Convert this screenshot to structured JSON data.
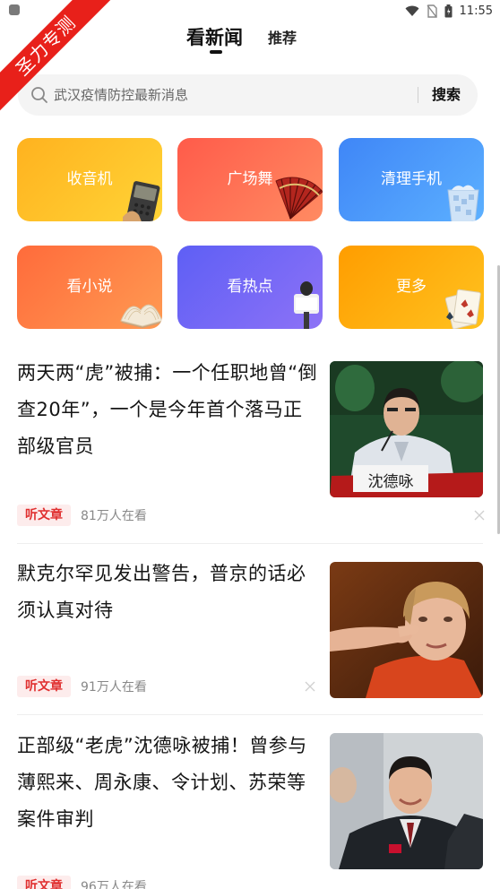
{
  "status_bar": {
    "time": "11:55",
    "icons": [
      "wifi-icon",
      "no-sim-icon",
      "battery-icon"
    ]
  },
  "watermark": {
    "text": "圣力专测"
  },
  "header": {
    "tabs": [
      {
        "label": "看新闻",
        "active": true
      },
      {
        "label": "推荐",
        "active": false
      }
    ]
  },
  "search": {
    "placeholder": "武汉疫情防控最新消息",
    "button_label": "搜索"
  },
  "shortcuts": [
    {
      "label": "收音机",
      "icon": "radio-icon",
      "color": "#ffbf28"
    },
    {
      "label": "广场舞",
      "icon": "fan-icon",
      "color": "#ff6a52"
    },
    {
      "label": "清理手机",
      "icon": "trash-bin-icon",
      "color": "#4c96fa"
    },
    {
      "label": "看小说",
      "icon": "book-icon",
      "color": "#ff7e45"
    },
    {
      "label": "看热点",
      "icon": "microphone-icon",
      "color": "#7367f5"
    },
    {
      "label": "更多",
      "icon": "playing-cards-icon",
      "color": "#ffb00f"
    }
  ],
  "news": [
    {
      "title": "两天两“虎”被捕：一个任职地曾“倒查20年”，一个是今年首个落马正部级官员",
      "tag": "听文章",
      "readers": "81万人在看",
      "thumb_text": "沈德咏"
    },
    {
      "title": "默克尔罕见发出警告，普京的话必须认真对待",
      "tag": "听文章",
      "readers": "91万人在看"
    },
    {
      "title": "正部级“老虎”沈德咏被捕！曾参与薄熙来、周永康、令计划、苏荣等案件审判",
      "tag": "听文章",
      "readers": "96万人在看"
    }
  ]
}
